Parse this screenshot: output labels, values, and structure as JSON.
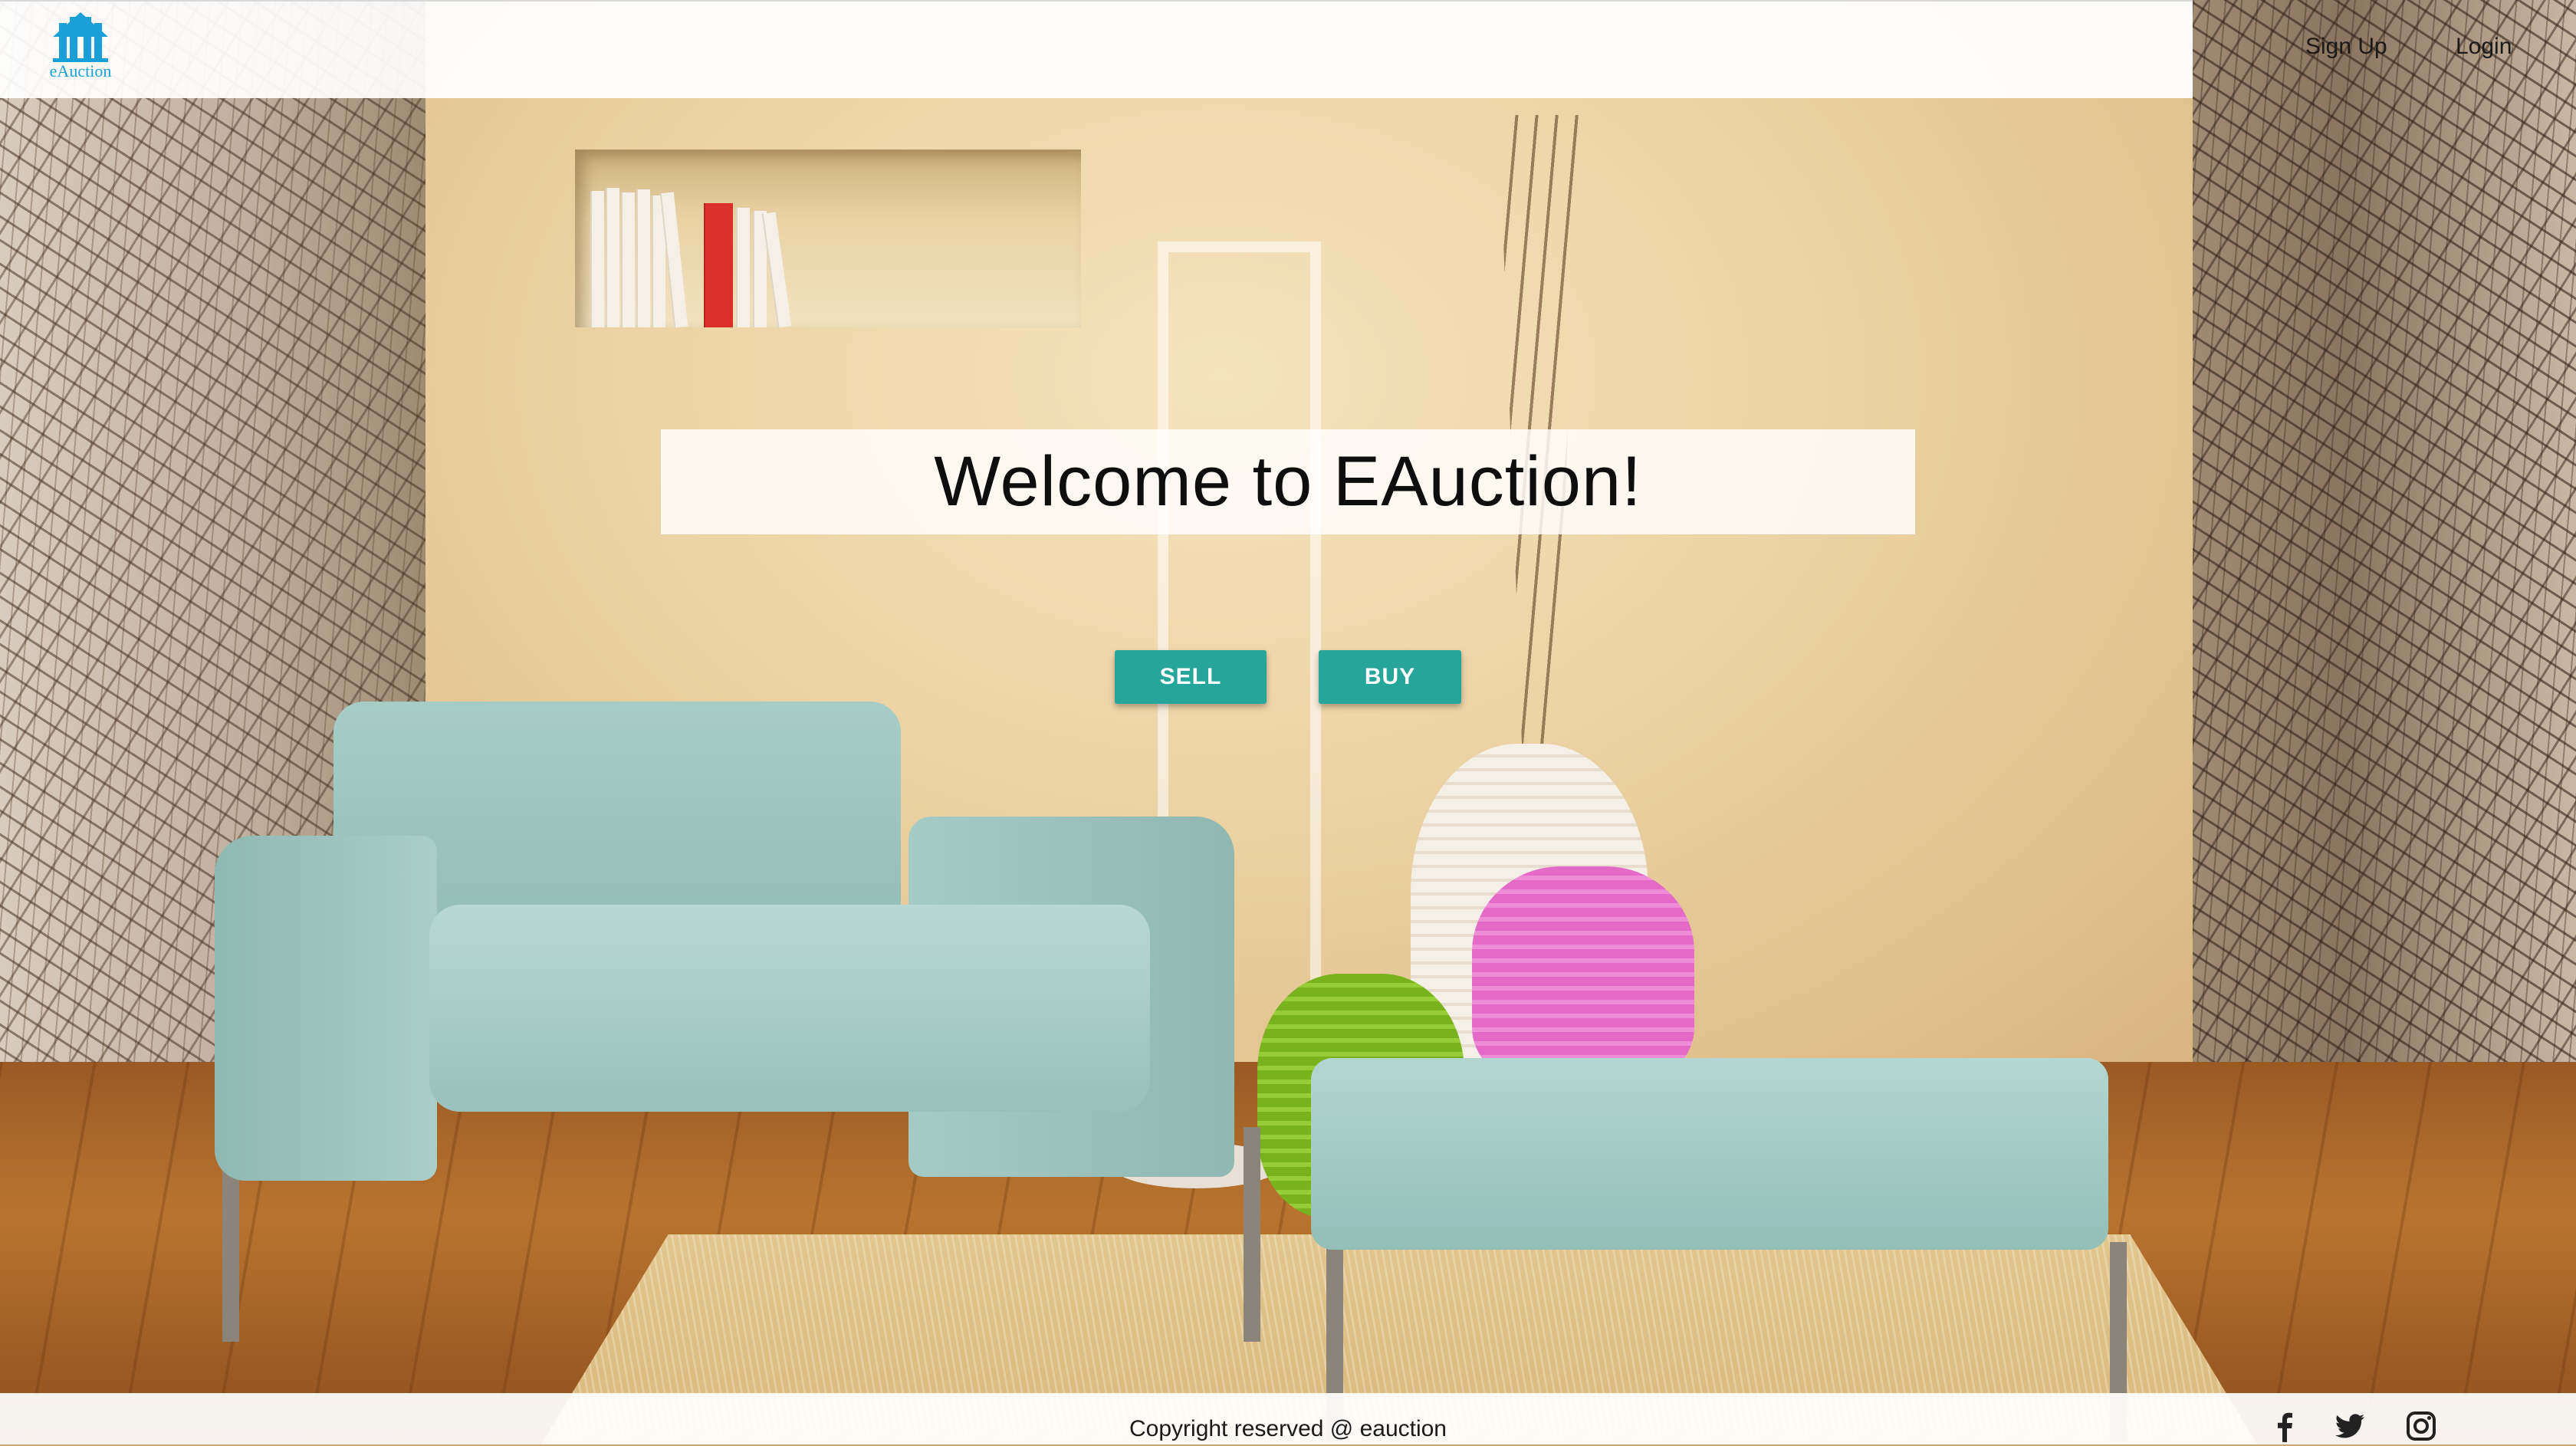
{
  "header": {
    "logo_text": "eAuction",
    "logo_icon": "gavel-house-logo",
    "nav": {
      "signup_label": "Sign Up",
      "login_label": "Login"
    }
  },
  "hero": {
    "title": "Welcome to EAuction!",
    "sell_label": "SELL",
    "buy_label": "BUY",
    "accent_color": "#26a69a"
  },
  "footer": {
    "copyright": "Copyright reserved @ eauction",
    "social_icons": [
      "facebook-icon",
      "twitter-icon",
      "instagram-icon"
    ]
  }
}
